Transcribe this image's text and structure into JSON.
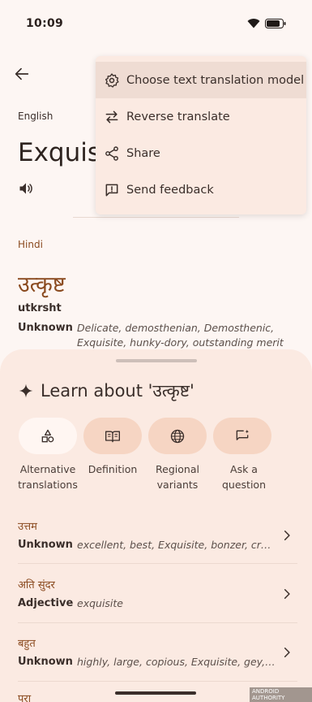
{
  "status_bar": {
    "time": "10:09"
  },
  "translation": {
    "source_language": "English",
    "source_text": "Exquisite",
    "target_language": "Hindi",
    "target_text": "उत्कृष्ट",
    "transliteration": "utkrsht",
    "part_of_speech": "Unknown",
    "synonyms": "Delicate, demosthenian, Demosthenic, Exquisite, hunky-dory, outstanding merit"
  },
  "menu": {
    "items": [
      {
        "label": "Choose text translation model",
        "icon": "gear-icon"
      },
      {
        "label": "Reverse translate",
        "icon": "swap-icon"
      },
      {
        "label": "Share",
        "icon": "share-icon"
      },
      {
        "label": "Send feedback",
        "icon": "feedback-icon"
      }
    ]
  },
  "learn": {
    "title": "Learn about 'उत्कृष्ट'",
    "chips": [
      {
        "label": "Alternative translations",
        "icon": "shapes-icon"
      },
      {
        "label": "Definition",
        "icon": "book-icon"
      },
      {
        "label": "Regional variants",
        "icon": "globe-icon"
      },
      {
        "label": "Ask a question",
        "icon": "chat-sparkle-icon"
      }
    ]
  },
  "alternatives": [
    {
      "word": "उत्तम",
      "pos": "Unknown",
      "synonyms": "excellent, best, Exquisite, bonzer, cream..."
    },
    {
      "word": "अति सुंदर",
      "pos": "Adjective",
      "synonyms": "exquisite"
    },
    {
      "word": "बहुत",
      "pos": "Unknown",
      "synonyms": "highly, large, copious, Exquisite, gey, int..."
    }
  ],
  "partial_row_word": "परा",
  "watermark": "ANDROID AUTHORITY",
  "colors": {
    "accent": "#8a4a1f",
    "sheet": "#fbeae2",
    "chip": "#f6d5c3"
  }
}
